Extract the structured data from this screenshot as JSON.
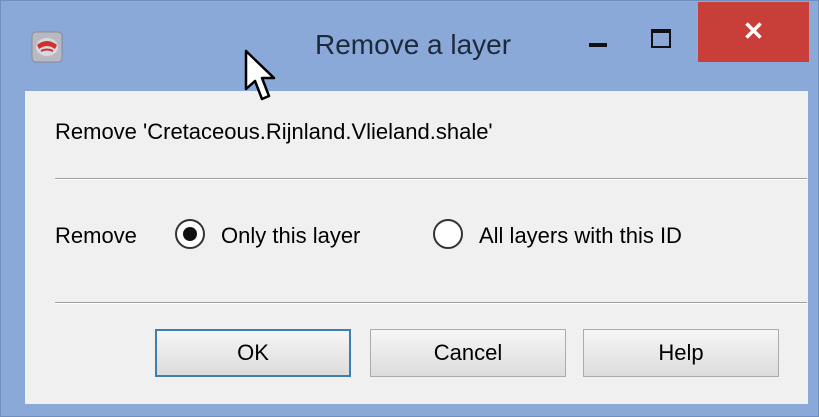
{
  "window": {
    "title": "Remove a layer",
    "close_glyph": "✕",
    "icons": {
      "app": "app-globe-icon",
      "minimize": "minimize-icon",
      "maximize": "maximize-icon",
      "close": "close-icon",
      "cursor": "mouse-pointer-icon"
    },
    "colors": {
      "frame": "#8aa8d8",
      "close_button": "#c73f38",
      "content": "#f0f0f0",
      "default_button_border": "#3c7fb1"
    }
  },
  "dialog": {
    "message": "Remove 'Cretaceous.Rijnland.Vlieland.shale'",
    "remove_label": "Remove",
    "options": [
      {
        "label": "Only this layer",
        "checked": true
      },
      {
        "label": "All layers with this ID",
        "checked": false
      }
    ],
    "buttons": {
      "ok": "OK",
      "cancel": "Cancel",
      "help": "Help"
    }
  }
}
